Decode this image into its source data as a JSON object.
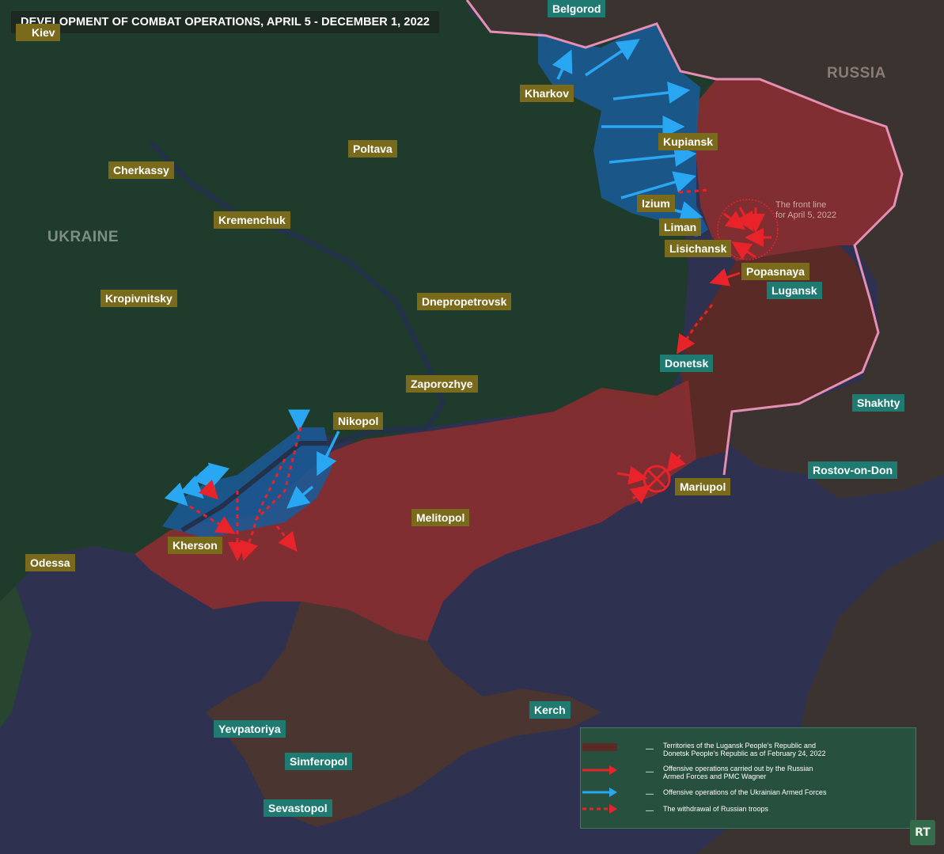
{
  "title": "DEVELOPMENT OF COMBAT OPERATIONS, APRIL 5 - DECEMBER 1, 2022",
  "countries": {
    "ukraine": "UKRAINE",
    "russia": "RUSSIA"
  },
  "cities": {
    "kiev": "Kiev",
    "belgorod": "Belgorod",
    "kharkov": "Kharkov",
    "poltava": "Poltava",
    "cherkassy": "Cherkassy",
    "kupiansk": "Kupiansk",
    "kremenchuk": "Kremenchuk",
    "izium": "Izium",
    "liman": "Liman",
    "lisichansk": "Lisichansk",
    "popasnaya": "Popasnaya",
    "lugansk": "Lugansk",
    "kropivnitsky": "Kropivnitsky",
    "dnepropetrovsk": "Dnepropetrovsk",
    "donetsk": "Donetsk",
    "zaporozhye": "Zaporozhye",
    "shakhty": "Shakhty",
    "nikopol": "Nikopol",
    "rostov": "Rostov-on-Don",
    "mariupol": "Mariupol",
    "melitopol": "Melitopol",
    "kherson": "Kherson",
    "odessa": "Odessa",
    "kerch": "Kerch",
    "yevpatoriya": "Yevpatoriya",
    "simferopol": "Simferopol",
    "sevastopol": "Sevastopol"
  },
  "front_note": {
    "line1": "The front line",
    "line2": "for April 5, 2022"
  },
  "legend": [
    {
      "label1": "Territories of the Lugansk People’s Republic and",
      "label2": "Donetsk People’s Republic  as of February 24, 2022",
      "symbol": "lpr-dpr-area"
    },
    {
      "label1": "Offensive operations carried out by the Russian",
      "label2": "Armed Forces and PMC Wagner",
      "symbol": "red-arrow"
    },
    {
      "label1": "Offensive operations of the Ukrainian Armed Forces",
      "label2": "",
      "symbol": "blue-arrow"
    },
    {
      "label1": "The withdrawal of Russian troops",
      "label2": "",
      "symbol": "red-dotted-arrow"
    }
  ],
  "logo": "RT",
  "colors": {
    "ukraine": "#1e3b2c",
    "russia_land": "#3b3330",
    "sea": "#2f3150",
    "russian_control": "#8a2f2f",
    "lpr_dpr": "#5a2b26",
    "ukr_offensive": "#1b5a93",
    "arrow_red": "#e8232a",
    "arrow_blue": "#29a7f2",
    "border": "#e58fb4",
    "ua_label": "#7a6a1c",
    "ru_label": "#1f7a72"
  }
}
